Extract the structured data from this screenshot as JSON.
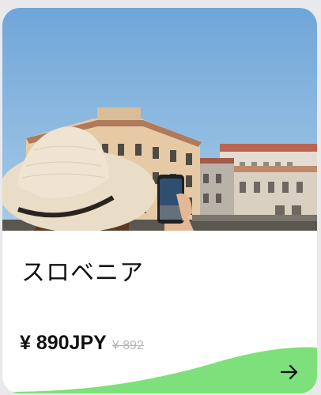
{
  "card": {
    "title": "スロベニア",
    "price": "¥ 890JPY",
    "original_price": "¥ 892",
    "action_icon": "arrow-right-icon"
  },
  "colors": {
    "accent_wave": "#7ee07a",
    "sky": "#7fb0dc",
    "text": "#111111",
    "strike_price": "#b5b5b5"
  }
}
